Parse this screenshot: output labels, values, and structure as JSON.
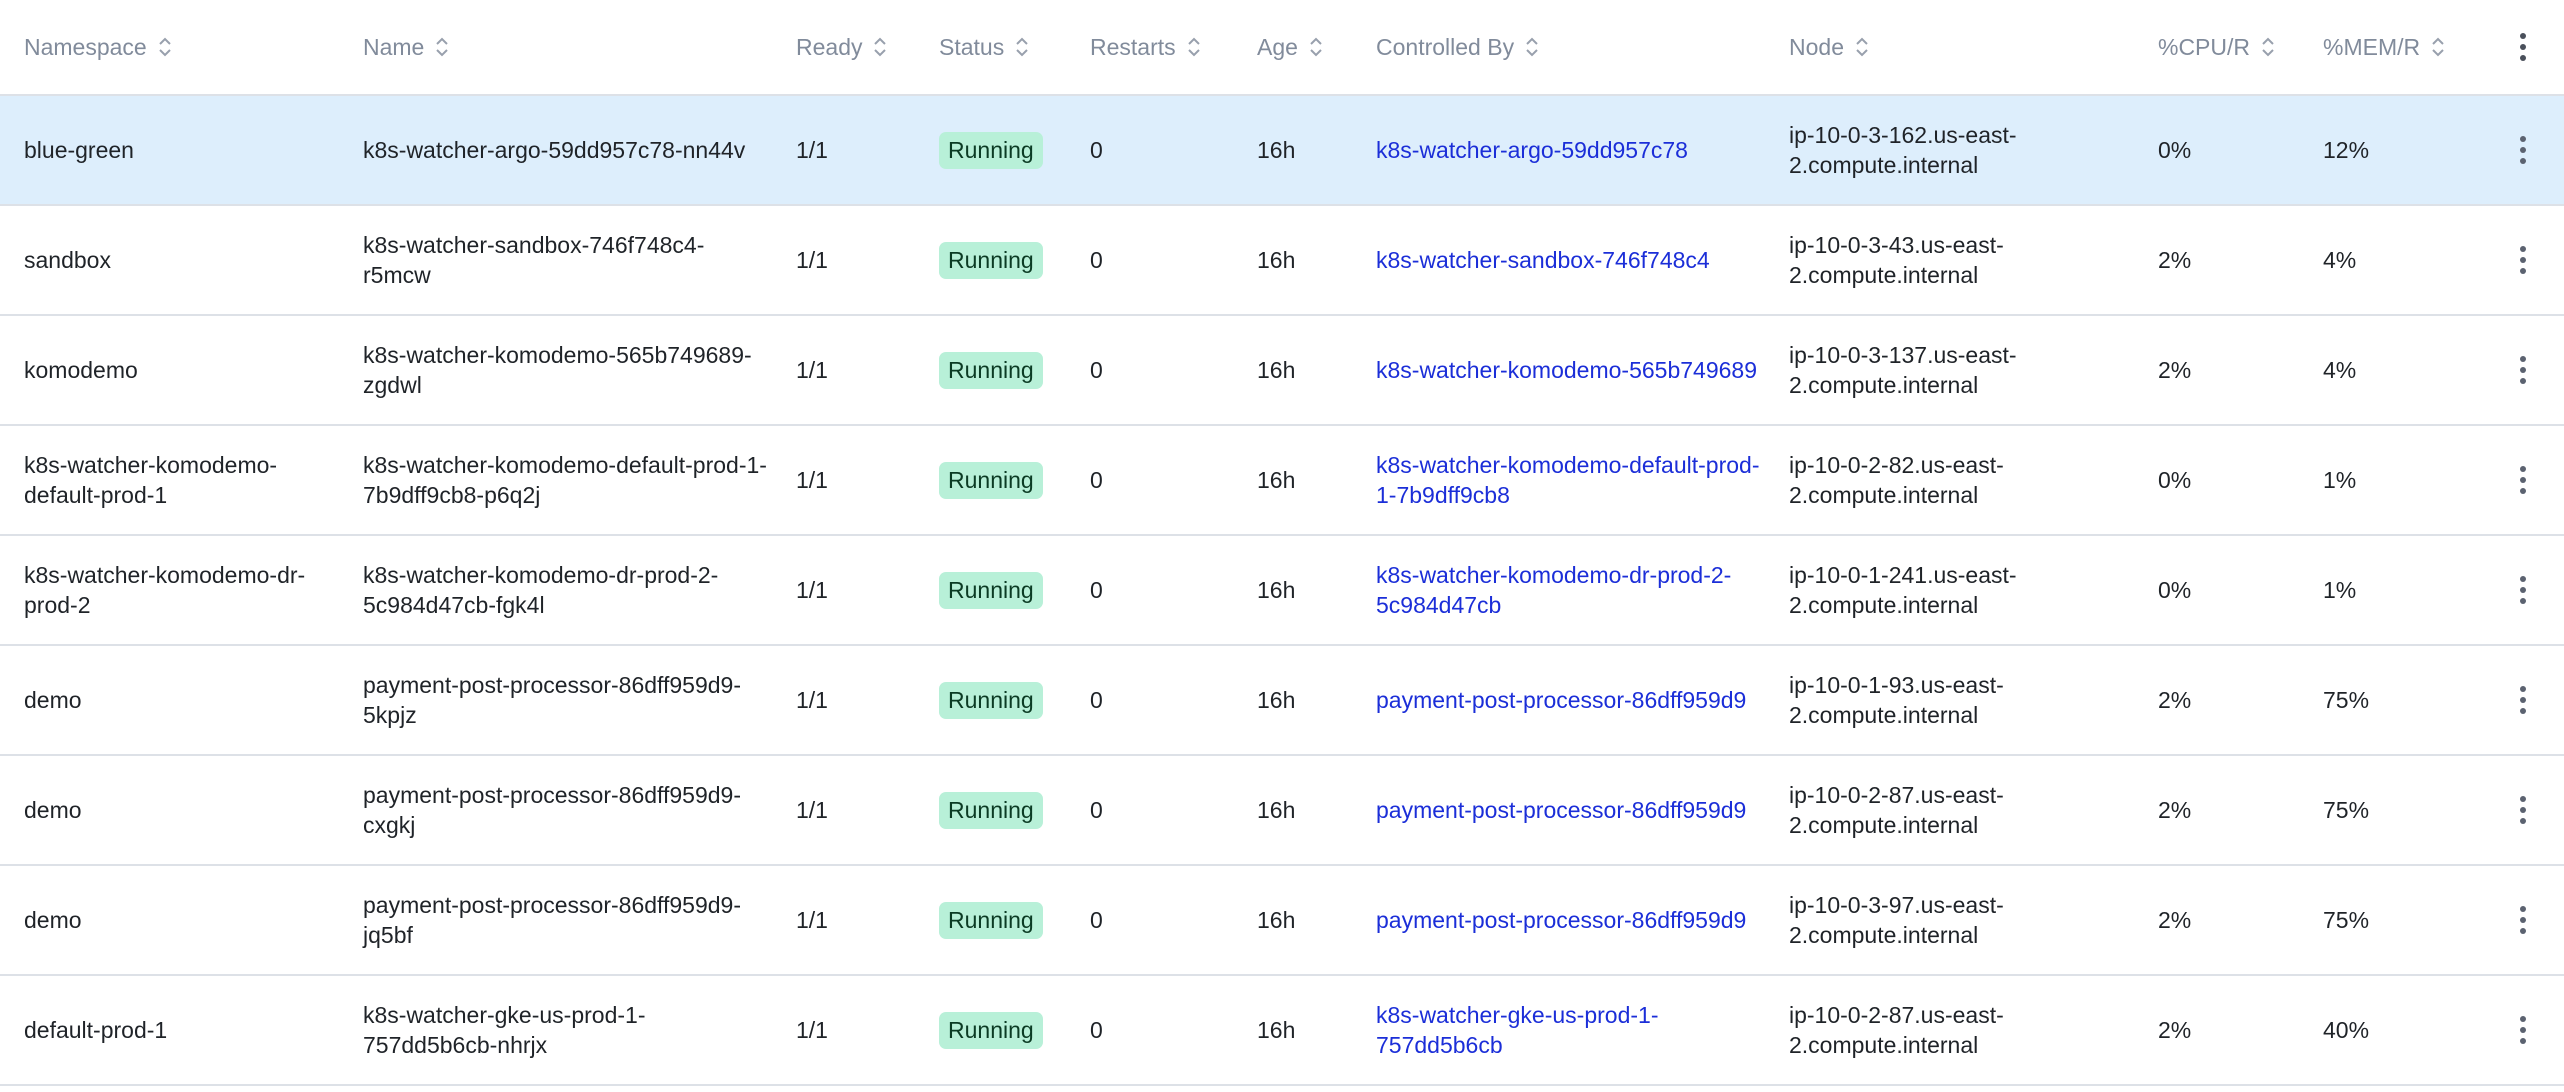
{
  "columns": [
    {
      "label": "Namespace"
    },
    {
      "label": "Name"
    },
    {
      "label": "Ready"
    },
    {
      "label": "Status"
    },
    {
      "label": "Restarts"
    },
    {
      "label": "Age"
    },
    {
      "label": "Controlled By"
    },
    {
      "label": "Node"
    },
    {
      "label": "%CPU/R"
    },
    {
      "label": "%MEM/R"
    }
  ],
  "header_menu_icon": "more-vertical-icon",
  "rows": [
    {
      "namespace": "blue-green",
      "name": "k8s-watcher-argo-59dd957c78-nn44v",
      "ready": "1/1",
      "status": "Running",
      "restarts": "0",
      "age": "16h",
      "controlled_by": "k8s-watcher-argo-59dd957c78",
      "node": "ip-10-0-3-162.us-east-2.compute.internal",
      "cpu": "0%",
      "mem": "12%",
      "selected": true
    },
    {
      "namespace": "sandbox",
      "name": "k8s-watcher-sandbox-746f748c4-r5mcw",
      "ready": "1/1",
      "status": "Running",
      "restarts": "0",
      "age": "16h",
      "controlled_by": "k8s-watcher-sandbox-746f748c4",
      "node": "ip-10-0-3-43.us-east-2.compute.internal",
      "cpu": "2%",
      "mem": "4%"
    },
    {
      "namespace": "komodemo",
      "name": "k8s-watcher-komodemo-565b749689-zgdwl",
      "ready": "1/1",
      "status": "Running",
      "restarts": "0",
      "age": "16h",
      "controlled_by": "k8s-watcher-komodemo-565b749689",
      "node": "ip-10-0-3-137.us-east-2.compute.internal",
      "cpu": "2%",
      "mem": "4%"
    },
    {
      "namespace": "k8s-watcher-komodemo-default-prod-1",
      "name": "k8s-watcher-komodemo-default-prod-1-7b9dff9cb8-p6q2j",
      "ready": "1/1",
      "status": "Running",
      "restarts": "0",
      "age": "16h",
      "controlled_by": "k8s-watcher-komodemo-default-prod-1-7b9dff9cb8",
      "node": "ip-10-0-2-82.us-east-2.compute.internal",
      "cpu": "0%",
      "mem": "1%"
    },
    {
      "namespace": "k8s-watcher-komodemo-dr-prod-2",
      "name": "k8s-watcher-komodemo-dr-prod-2-5c984d47cb-fgk4l",
      "ready": "1/1",
      "status": "Running",
      "restarts": "0",
      "age": "16h",
      "controlled_by": "k8s-watcher-komodemo-dr-prod-2-5c984d47cb",
      "node": "ip-10-0-1-241.us-east-2.compute.internal",
      "cpu": "0%",
      "mem": "1%"
    },
    {
      "namespace": "demo",
      "name": "payment-post-processor-86dff959d9-5kpjz",
      "ready": "1/1",
      "status": "Running",
      "restarts": "0",
      "age": "16h",
      "controlled_by": "payment-post-processor-86dff959d9",
      "node": "ip-10-0-1-93.us-east-2.compute.internal",
      "cpu": "2%",
      "mem": "75%"
    },
    {
      "namespace": "demo",
      "name": "payment-post-processor-86dff959d9-cxgkj",
      "ready": "1/1",
      "status": "Running",
      "restarts": "0",
      "age": "16h",
      "controlled_by": "payment-post-processor-86dff959d9",
      "node": "ip-10-0-2-87.us-east-2.compute.internal",
      "cpu": "2%",
      "mem": "75%"
    },
    {
      "namespace": "demo",
      "name": "payment-post-processor-86dff959d9-jq5bf",
      "ready": "1/1",
      "status": "Running",
      "restarts": "0",
      "age": "16h",
      "controlled_by": "payment-post-processor-86dff959d9",
      "node": "ip-10-0-3-97.us-east-2.compute.internal",
      "cpu": "2%",
      "mem": "75%"
    },
    {
      "namespace": "default-prod-1",
      "name": "k8s-watcher-gke-us-prod-1-757dd5b6cb-nhrjx",
      "ready": "1/1",
      "status": "Running",
      "restarts": "0",
      "age": "16h",
      "controlled_by": "k8s-watcher-gke-us-prod-1-757dd5b6cb",
      "node": "ip-10-0-2-87.us-east-2.compute.internal",
      "cpu": "2%",
      "mem": "40%"
    }
  ],
  "colors": {
    "header_text": "#818b9b",
    "link": "#1b2ed8",
    "status_running_bg": "#b8f0d8",
    "selected_row_bg": "#ddeefc",
    "divider": "#dde1e7"
  }
}
